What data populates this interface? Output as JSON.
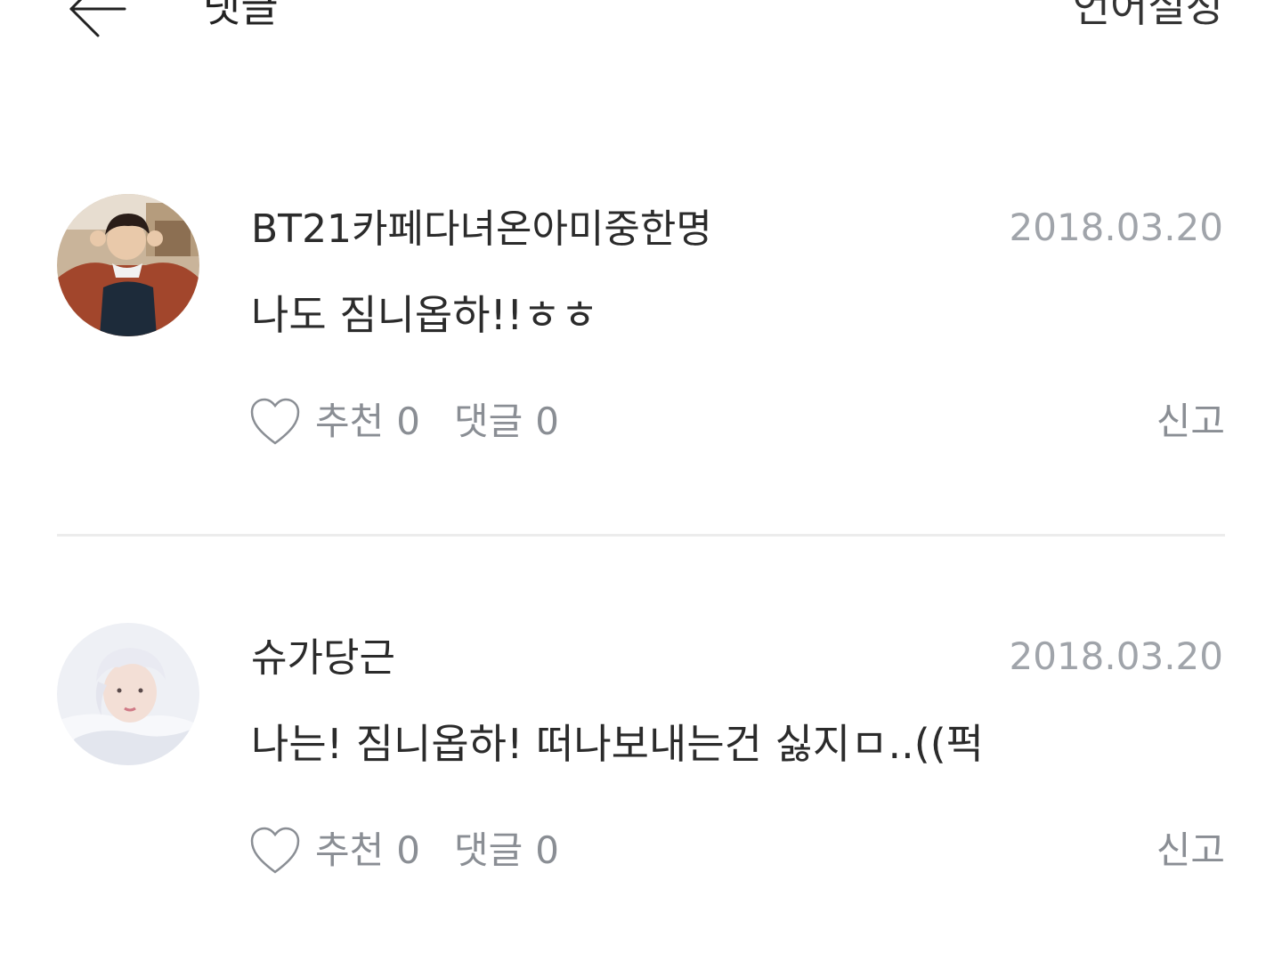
{
  "header": {
    "back_icon": "arrow-left-icon",
    "title": "댓글",
    "language_settings": "언어설정"
  },
  "comments": [
    {
      "username": "BT21카페다녀온아미중한명",
      "date": "2018.03.20",
      "text": "나도 짐니옵하!!ㅎㅎ",
      "like_label": "추천",
      "like_count": "0",
      "reply_label": "댓글",
      "reply_count": "0",
      "report_label": "신고",
      "avatar_icon": "profile-photo"
    },
    {
      "username": "슈가당근",
      "date": "2018.03.20",
      "text": "나는! 짐니옵하! 떠나보내는건 싫지ㅁ..((퍽",
      "like_label": "추천",
      "like_count": "0",
      "reply_label": "댓글",
      "reply_count": "0",
      "report_label": "신고",
      "avatar_icon": "profile-photo"
    }
  ],
  "colors": {
    "text_primary": "#2b2b2b",
    "text_secondary": "#8a8e94",
    "date": "#a0a4aa",
    "divider": "#ececec"
  }
}
